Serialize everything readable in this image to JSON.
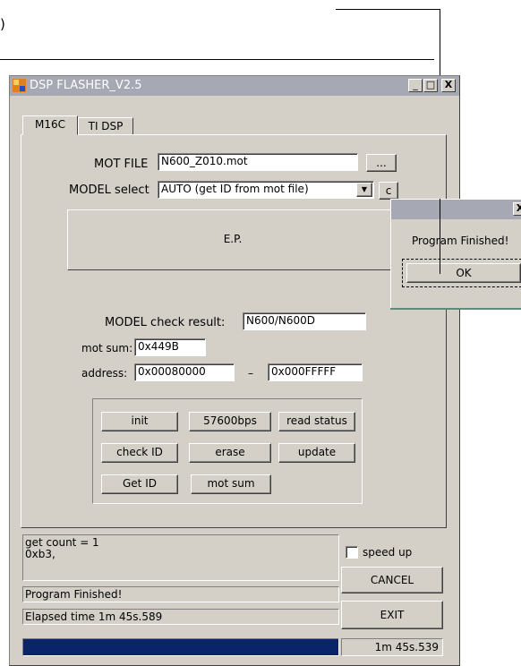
{
  "top_label": ")",
  "window": {
    "title": "DSP FLASHER_V2.5",
    "min_btn": "_",
    "max_btn": "□",
    "close_btn": "X"
  },
  "tabs": [
    "M16C",
    "TI DSP"
  ],
  "form": {
    "mot_file_label": "MOT FILE",
    "mot_file_value": "N600_Z010.mot",
    "browse_label": "...",
    "model_select_label": "MODEL select",
    "model_select_value": "AUTO (get ID from mot file)",
    "model_side_btn": "c",
    "ep_text": "E.P.",
    "model_check_label": "MODEL check result:",
    "model_check_value": "N600/N600D",
    "mot_sum_label": "mot sum:",
    "mot_sum_value": "0x449B",
    "address_label": "address:",
    "address_from": "0x00080000",
    "address_dash": "–",
    "address_to": "0x000FFFFF"
  },
  "buttons": {
    "init": "init",
    "baud": "57600bps",
    "read_status": "read status",
    "check_id": "check ID",
    "erase": "erase",
    "update": "update",
    "get_id": "Get ID",
    "mot_sum": "mot sum"
  },
  "log": {
    "line1": "get count = 1",
    "line2": "0xb3,"
  },
  "status": {
    "message": "Program Finished!",
    "elapsed": "Elapsed time 1m 45s.589",
    "progress": 1.0,
    "time_box": "1m 45s.539"
  },
  "side": {
    "speed_up_label": "speed up",
    "speed_up_checked": false,
    "cancel_label": "CANCEL",
    "exit_label": "EXIT"
  },
  "dialog": {
    "close_btn": "X",
    "message": "Program Finished!",
    "ok_label": "OK"
  },
  "colors": {
    "face": "#d4d0c8",
    "progress": "#0a246a",
    "inactive_title": "#a6a8b3"
  }
}
